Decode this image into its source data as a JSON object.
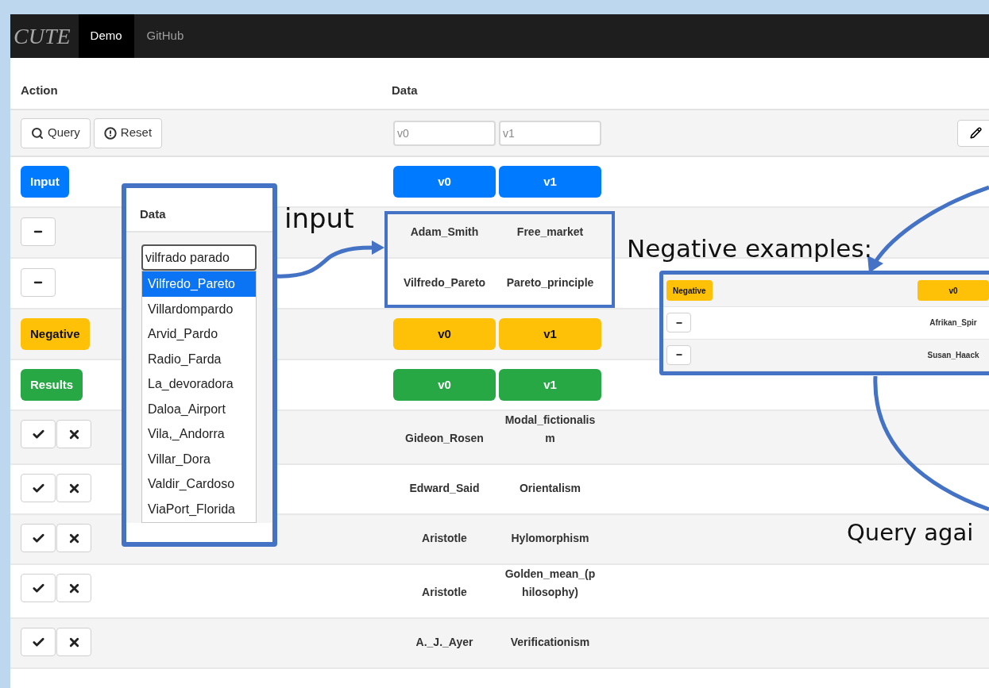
{
  "navbar": {
    "brand": "CUTE",
    "tabs": [
      {
        "label": "Demo",
        "selected": true
      },
      {
        "label": "GitHub",
        "selected": false
      }
    ]
  },
  "table": {
    "headers": [
      "Action",
      "Data"
    ],
    "toolbar": {
      "buttons": [
        {
          "label": "Query"
        },
        {
          "label": "Reset"
        }
      ],
      "fields": [
        {
          "placeholder": "v0"
        },
        {
          "placeholder": "v1"
        }
      ]
    },
    "rows": [
      {
        "kind": "section",
        "label": "Input",
        "color": "#007bff",
        "cells": [
          "v0",
          "v1"
        ]
      },
      {
        "kind": "example",
        "cells": [
          "Adam_Smith",
          "Free_market"
        ]
      },
      {
        "kind": "example",
        "cells": [
          "Vilfredo_Pareto",
          "Pareto_principle"
        ]
      },
      {
        "kind": "section",
        "label": "Negative",
        "color": "#ffc107",
        "cells": [
          "v0",
          "v1"
        ]
      },
      {
        "kind": "section",
        "label": "Results",
        "color": "#28a745",
        "cells": [
          "v0",
          "v1"
        ]
      },
      {
        "kind": "result",
        "cells": [
          "Gideon_Rosen",
          "Modal_fictionalism"
        ]
      },
      {
        "kind": "result",
        "cells": [
          "Edward_Said",
          "Orientalism"
        ]
      },
      {
        "kind": "result",
        "cells": [
          "Aristotle",
          "Hylomorphism"
        ]
      },
      {
        "kind": "result",
        "cells": [
          "Aristotle",
          "Golden_mean_(philosophy)"
        ]
      },
      {
        "kind": "result",
        "cells": [
          "A._J._Ayer",
          "Verificationism"
        ]
      }
    ]
  },
  "autocomplete": {
    "header": "Data",
    "value": "vilfrado parado",
    "options": [
      {
        "label": "Vilfredo_Pareto",
        "selected": true
      },
      {
        "label": "Villardompardo",
        "selected": false
      },
      {
        "label": "Arvid_Pardo",
        "selected": false
      },
      {
        "label": "Radio_Farda",
        "selected": false
      },
      {
        "label": "La_devoradora",
        "selected": false
      },
      {
        "label": "Daloa_Airport",
        "selected": false
      },
      {
        "label": "Vila,_Andorra",
        "selected": false
      },
      {
        "label": "Villar_Dora",
        "selected": false
      },
      {
        "label": "Valdir_Cardoso",
        "selected": false
      },
      {
        "label": "ViaPort_Florida",
        "selected": false
      }
    ]
  },
  "annotations": {
    "input_label": "input",
    "negative_label": "Negative examples:",
    "query_label": "Query agai"
  },
  "negative_box": {
    "button": {
      "label": "Negative",
      "color": "#ffc107"
    },
    "column": "v0",
    "rows": [
      "Afrikan_Spir",
      "Susan_Haack"
    ]
  }
}
